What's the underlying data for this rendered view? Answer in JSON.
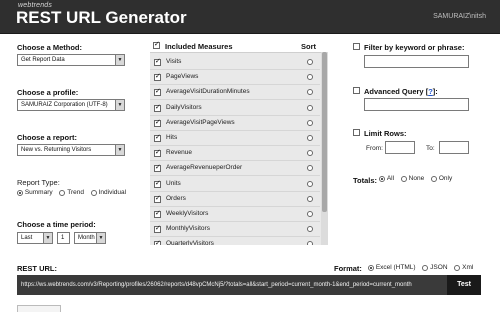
{
  "header": {
    "brand": "webtrends",
    "title": "REST URL Generator",
    "user": "SAMURAIZ\\nitsh"
  },
  "method": {
    "label": "Choose a Method:",
    "value": "Get Report Data"
  },
  "profile": {
    "label": "Choose a profile:",
    "value": "SAMURAIZ Corporation (UTF-8)"
  },
  "report": {
    "label": "Choose a report:",
    "value": "New vs. Returning Visitors"
  },
  "report_type": {
    "label": "Report Type:",
    "options": [
      "Summary",
      "Trend",
      "Individual"
    ],
    "selected": "Summary"
  },
  "time_period": {
    "label": "Choose a time period:",
    "relative": "Last",
    "amount": "1",
    "unit": "Month"
  },
  "measures": {
    "label": "Included Measures",
    "sort_label": "Sort",
    "items": [
      "Visits",
      "PageViews",
      "AverageVisitDurationMinutes",
      "DailyVisitors",
      "AverageVisitPageViews",
      "Hits",
      "Revenue",
      "AverageRevenueperOrder",
      "Units",
      "Orders",
      "WeeklyVisitors",
      "MonthlyVisitors",
      "QuarterlyVisitors"
    ]
  },
  "filter": {
    "label": "Filter by keyword or phrase:",
    "value": ""
  },
  "advanced_query": {
    "label_before": "Advanced Query [",
    "link": "?",
    "label_after": "]:",
    "value": ""
  },
  "limit_rows": {
    "label": "Limit Rows:",
    "from_label": "From:",
    "to_label": "To:",
    "from": "",
    "to": ""
  },
  "totals": {
    "label": "Totals:",
    "options": [
      "All",
      "None",
      "Only"
    ],
    "selected": "All"
  },
  "rest_url": {
    "label": "REST URL:",
    "value": "https://ws.webtrends.com/v3/Reporting/profiles/26062/reports/d48vpCMcNj5/?totals=all&start_period=current_month-1&end_period=current_month",
    "test_label": "Test"
  },
  "format": {
    "label": "Format:",
    "options": [
      "Excel (HTML)",
      "JSON",
      "Xml"
    ],
    "selected": "Excel (HTML)"
  }
}
